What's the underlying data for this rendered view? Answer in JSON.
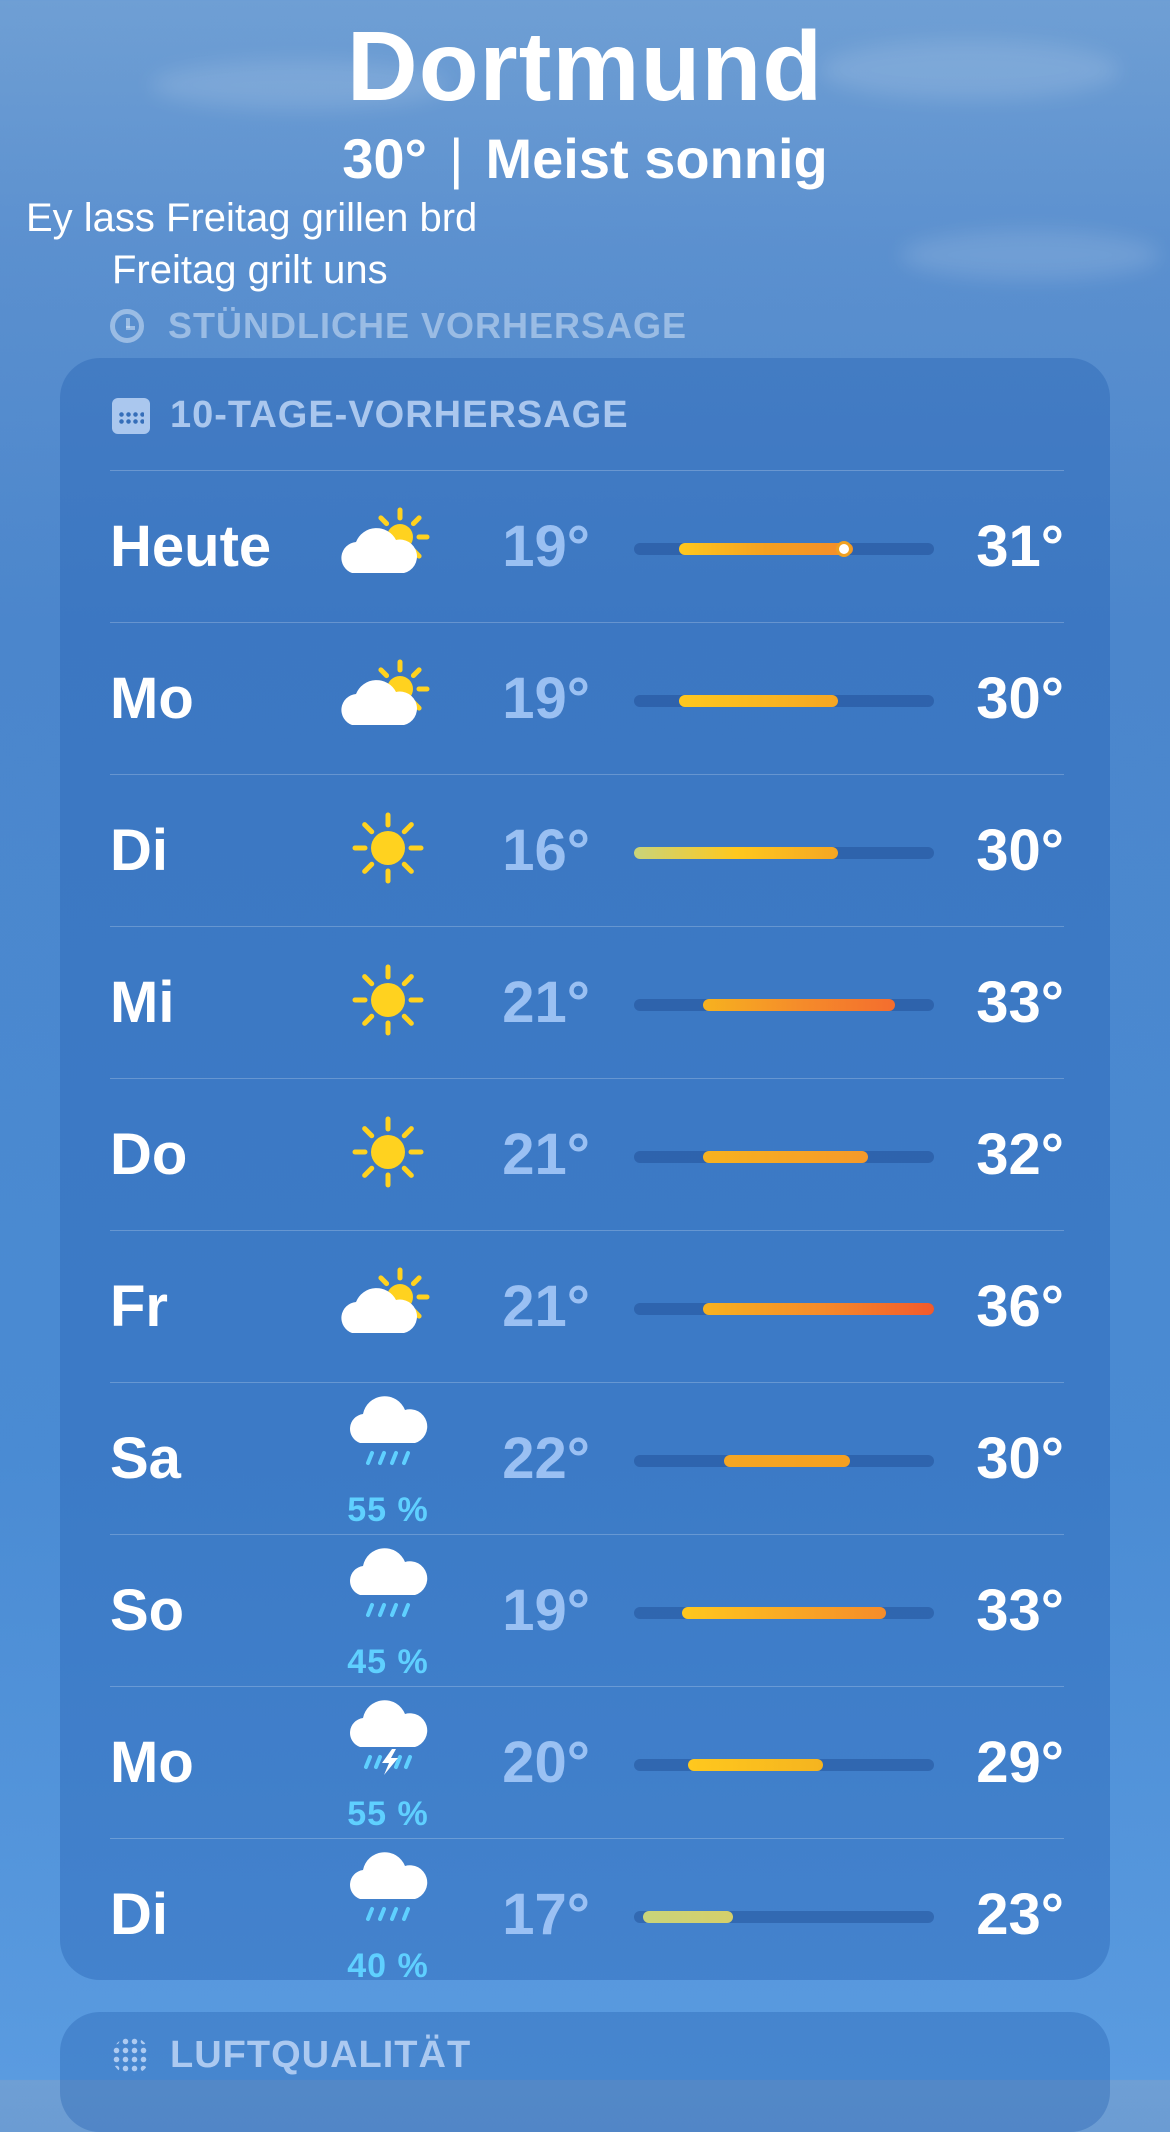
{
  "header": {
    "city": "Dortmund",
    "temp": "30°",
    "separator": "|",
    "condition": "Meist sonnig"
  },
  "captions": [
    "Ey lass Freitag grillen brd",
    "Freitag grilt uns"
  ],
  "hourly": {
    "title": "STÜNDLICHE VORHERSAGE",
    "icon": "clock-icon"
  },
  "forecast": {
    "title": "10-TAGE-VORHERSAGE",
    "icon": "calendar-icon",
    "days": [
      {
        "day": "Heute",
        "icon": "partly-sunny-icon",
        "precip": "",
        "low": "19°",
        "high": "31°",
        "bar_start": 0.15,
        "bar_end": 0.73,
        "colors": [
          "#ffc81e",
          "#f5a020",
          "#f58c2a"
        ],
        "current": 0.7
      },
      {
        "day": "Mo",
        "icon": "partly-sunny-icon",
        "precip": "",
        "low": "19°",
        "high": "30°",
        "bar_start": 0.15,
        "bar_end": 0.68,
        "colors": [
          "#ffc81e",
          "#f5a623"
        ]
      },
      {
        "day": "Di",
        "icon": "sun-icon",
        "precip": "",
        "low": "16°",
        "high": "30°",
        "bar_start": 0.0,
        "bar_end": 0.68,
        "colors": [
          "#c9d47a",
          "#ffc81e",
          "#f5a623"
        ]
      },
      {
        "day": "Mi",
        "icon": "sun-icon",
        "precip": "",
        "low": "21°",
        "high": "33°",
        "bar_start": 0.23,
        "bar_end": 0.87,
        "colors": [
          "#f7b21f",
          "#f58c2a",
          "#f46d2e"
        ]
      },
      {
        "day": "Do",
        "icon": "sun-icon",
        "precip": "",
        "low": "21°",
        "high": "32°",
        "bar_start": 0.23,
        "bar_end": 0.78,
        "colors": [
          "#f7b21f",
          "#f5992a"
        ]
      },
      {
        "day": "Fr",
        "icon": "partly-sunny-icon",
        "precip": "",
        "low": "21°",
        "high": "36°",
        "bar_start": 0.23,
        "bar_end": 1.0,
        "colors": [
          "#f7b21f",
          "#f58c2a",
          "#f25a2c"
        ]
      },
      {
        "day": "Sa",
        "icon": "rain-icon",
        "precip": "55 %",
        "low": "22°",
        "high": "30°",
        "bar_start": 0.3,
        "bar_end": 0.72,
        "colors": [
          "#f5a623",
          "#f5a020"
        ]
      },
      {
        "day": "So",
        "icon": "rain-icon",
        "precip": "45 %",
        "low": "19°",
        "high": "33°",
        "bar_start": 0.16,
        "bar_end": 0.84,
        "colors": [
          "#ffc81e",
          "#f58c2a"
        ]
      },
      {
        "day": "Mo",
        "icon": "thunderstorm-icon",
        "precip": "55 %",
        "low": "20°",
        "high": "29°",
        "bar_start": 0.18,
        "bar_end": 0.63,
        "colors": [
          "#ffc81e",
          "#f5b41f"
        ]
      },
      {
        "day": "Di",
        "icon": "rain-icon",
        "precip": "40 %",
        "low": "17°",
        "high": "23°",
        "bar_start": 0.03,
        "bar_end": 0.33,
        "colors": [
          "#c9d47a",
          "#d6cf6a"
        ]
      }
    ]
  },
  "air_quality": {
    "title": "LUFTQUALITÄT",
    "icon": "air-quality-icon"
  }
}
